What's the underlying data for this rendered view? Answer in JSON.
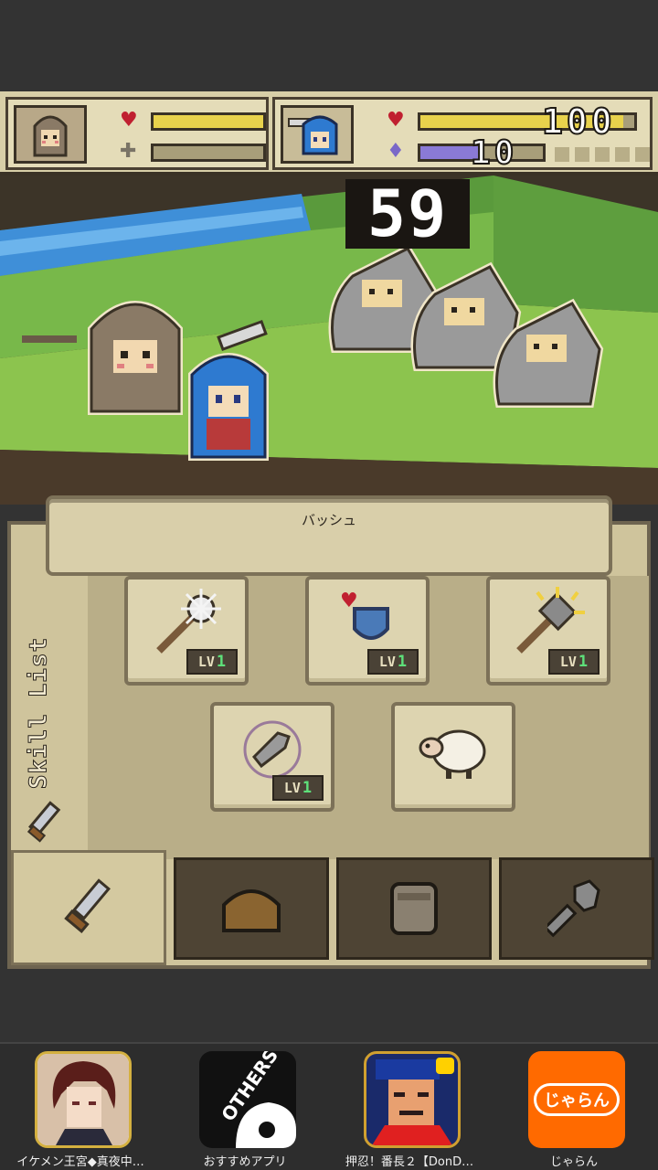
{
  "status": {
    "hp_value": "100",
    "sp_value": "10",
    "player1": {
      "hp_fraction": 1.0,
      "sp_fraction": 0.0
    },
    "player2": {
      "hp_fraction": 0.95,
      "sp_fraction": 0.47
    }
  },
  "battle": {
    "timer": "59"
  },
  "skill_panel": {
    "selected_skill_name": "バッシュ",
    "side_label": "Skill List",
    "level_prefix": "LV",
    "skills": [
      {
        "icon": "spiked-mace-icon",
        "level": "1"
      },
      {
        "icon": "shield-heart-icon",
        "level": "1"
      },
      {
        "icon": "sparkling-hammer-icon",
        "level": "1"
      },
      {
        "icon": "sword-circle-icon",
        "level": "1"
      },
      {
        "icon": "sheep-icon",
        "level": ""
      }
    ],
    "tabs": [
      {
        "icon": "sword-icon",
        "active": true
      },
      {
        "icon": "bread-icon",
        "active": false
      },
      {
        "icon": "jar-icon",
        "active": false
      },
      {
        "icon": "wrench-icon",
        "active": false
      }
    ]
  },
  "ads": [
    {
      "label": "イケメン王宮◆真夜中…",
      "icon": "ikemen-app-icon"
    },
    {
      "label": "おすすめアプリ",
      "icon": "others-app-icon",
      "icon_text": "OTHERS"
    },
    {
      "label": "押忍！番長２【DonD…",
      "icon": "oshu-bancho-app-icon"
    },
    {
      "label": "じゃらん",
      "icon": "jalan-app-icon",
      "icon_text": "じゃらん"
    }
  ],
  "colors": {
    "hp_bar": "#e8d24c",
    "sp_bar": "#8a7ad6",
    "level_number": "#5ee07a",
    "jalan_orange": "#ff6a00"
  }
}
